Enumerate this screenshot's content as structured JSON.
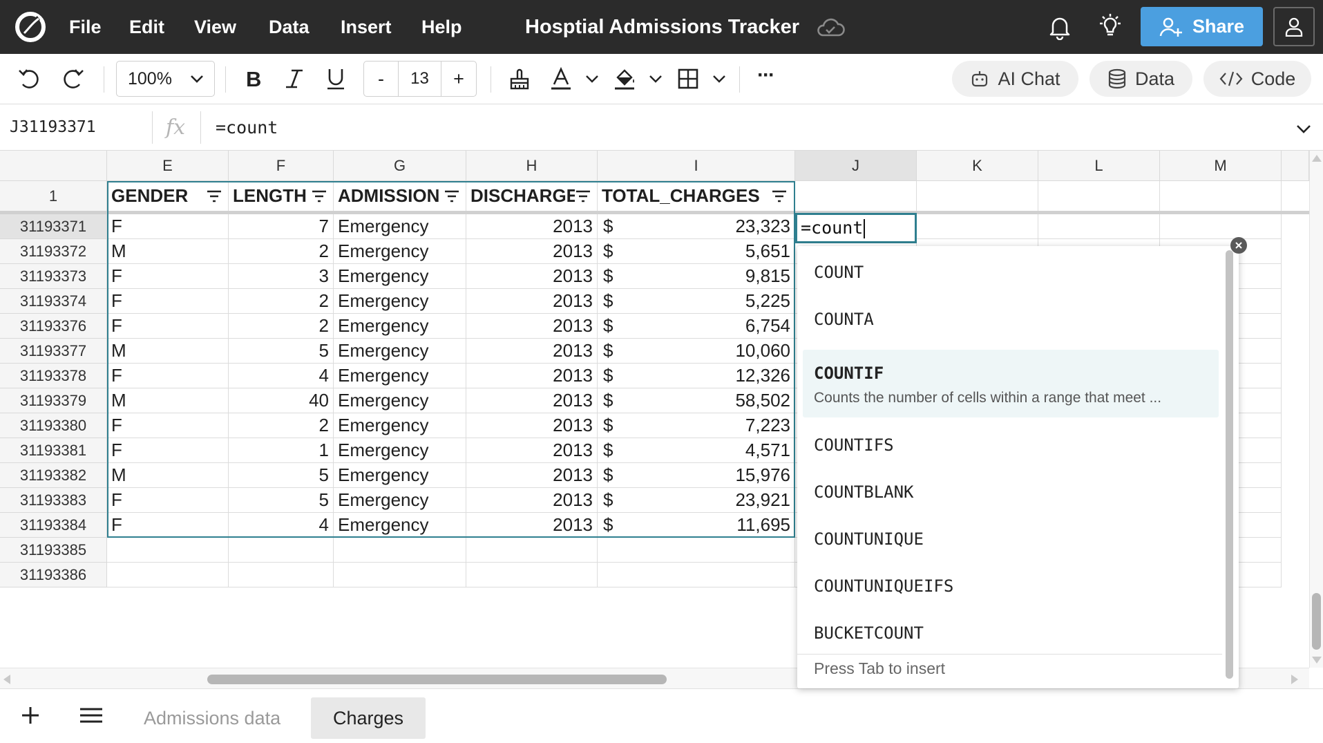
{
  "app": {
    "title": "Hosptial Admissions Tracker",
    "menu": [
      "File",
      "Edit",
      "View",
      "Data",
      "Insert",
      "Help"
    ],
    "share_label": "Share",
    "accent_color": "#4b9fe0"
  },
  "toolbar": {
    "zoom": "100%",
    "font_size": "13",
    "font_dec": "-",
    "font_inc": "+",
    "ai_chat_label": "AI Chat",
    "data_label": "Data",
    "code_label": "Code",
    "more_label": "···"
  },
  "formula_bar": {
    "cell_ref": "J31193371",
    "fx_label": "fx",
    "formula": "=count"
  },
  "grid": {
    "columns": [
      "E",
      "F",
      "G",
      "H",
      "I",
      "J",
      "K",
      "L",
      "M"
    ],
    "active_column": "J",
    "header_row_number": "1",
    "headers": [
      "GENDER",
      "LENGTH",
      "ADMISSION",
      "DISCHARGE",
      "TOTAL_CHARGES"
    ],
    "rows": [
      {
        "id": "31193371",
        "gender": "F",
        "length": "7",
        "admission": "Emergency",
        "discharge": "2013",
        "currency": "$",
        "charges": "23,323"
      },
      {
        "id": "31193372",
        "gender": "M",
        "length": "2",
        "admission": "Emergency",
        "discharge": "2013",
        "currency": "$",
        "charges": "5,651"
      },
      {
        "id": "31193373",
        "gender": "F",
        "length": "3",
        "admission": "Emergency",
        "discharge": "2013",
        "currency": "$",
        "charges": "9,815"
      },
      {
        "id": "31193374",
        "gender": "F",
        "length": "2",
        "admission": "Emergency",
        "discharge": "2013",
        "currency": "$",
        "charges": "5,225"
      },
      {
        "id": "31193376",
        "gender": "F",
        "length": "2",
        "admission": "Emergency",
        "discharge": "2013",
        "currency": "$",
        "charges": "6,754"
      },
      {
        "id": "31193377",
        "gender": "M",
        "length": "5",
        "admission": "Emergency",
        "discharge": "2013",
        "currency": "$",
        "charges": "10,060"
      },
      {
        "id": "31193378",
        "gender": "F",
        "length": "4",
        "admission": "Emergency",
        "discharge": "2013",
        "currency": "$",
        "charges": "12,326"
      },
      {
        "id": "31193379",
        "gender": "M",
        "length": "40",
        "admission": "Emergency",
        "discharge": "2013",
        "currency": "$",
        "charges": "58,502"
      },
      {
        "id": "31193380",
        "gender": "F",
        "length": "2",
        "admission": "Emergency",
        "discharge": "2013",
        "currency": "$",
        "charges": "7,223"
      },
      {
        "id": "31193381",
        "gender": "F",
        "length": "1",
        "admission": "Emergency",
        "discharge": "2013",
        "currency": "$",
        "charges": "4,571"
      },
      {
        "id": "31193382",
        "gender": "M",
        "length": "5",
        "admission": "Emergency",
        "discharge": "2013",
        "currency": "$",
        "charges": "15,976"
      },
      {
        "id": "31193383",
        "gender": "F",
        "length": "5",
        "admission": "Emergency",
        "discharge": "2013",
        "currency": "$",
        "charges": "23,921"
      },
      {
        "id": "31193384",
        "gender": "F",
        "length": "4",
        "admission": "Emergency",
        "discharge": "2013",
        "currency": "$",
        "charges": "11,695"
      }
    ],
    "empty_rows": [
      "31193385",
      "31193386"
    ],
    "active_cell_value": "=count"
  },
  "autocomplete": {
    "items": [
      {
        "name": "COUNT"
      },
      {
        "name": "COUNTA"
      },
      {
        "name": "COUNTIF",
        "description": "Counts the number of cells within a range that meet ..."
      },
      {
        "name": "COUNTIFS"
      },
      {
        "name": "COUNTBLANK"
      },
      {
        "name": "COUNTUNIQUE"
      },
      {
        "name": "COUNTUNIQUEIFS"
      },
      {
        "name": "BUCKETCOUNT"
      }
    ],
    "selected": "COUNTIF",
    "hint": "Press Tab to insert"
  },
  "sheets": {
    "tabs": [
      "Admissions data",
      "Charges"
    ],
    "active": "Charges"
  }
}
